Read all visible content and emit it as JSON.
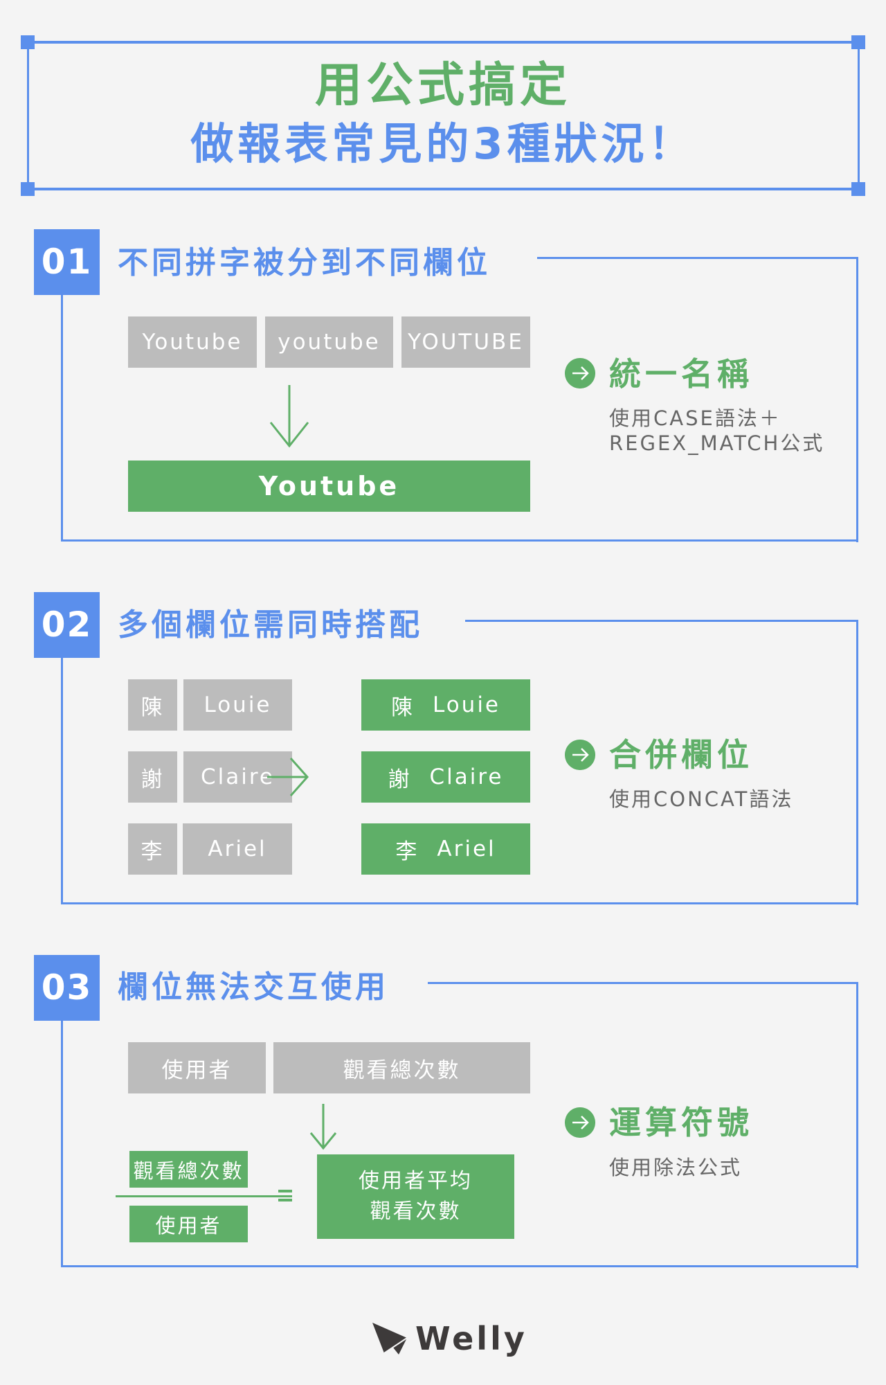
{
  "colors": {
    "background": "#f4f4f4",
    "accent_blue": "#5b8fec",
    "accent_green": "#5faf68",
    "gray_cell": "#bcbcbc",
    "desc_text": "#666666",
    "logo": "#3d3a3a"
  },
  "header": {
    "title_line1": "用公式搞定",
    "title_line2": "做報表常見的3種狀況！"
  },
  "sections": [
    {
      "number": "01",
      "title": "不同拼字被分到不同欄位",
      "inputs": [
        "Youtube",
        "youtube",
        "YOUTUBE"
      ],
      "output": "Youtube",
      "result_icon": "arrow-right-circle-icon",
      "result_title": "統一名稱",
      "result_desc_lines": [
        "使用CASE語法＋",
        "REGEX_MATCH公式"
      ]
    },
    {
      "number": "02",
      "title": "多個欄位需同時搭配",
      "rows": [
        {
          "surname": "陳",
          "name": "Louie"
        },
        {
          "surname": "謝",
          "name": "Claire"
        },
        {
          "surname": "李",
          "name": "Ariel"
        }
      ],
      "result_icon": "arrow-right-circle-icon",
      "result_title": "合併欄位",
      "result_desc_lines": [
        "使用CONCAT語法"
      ]
    },
    {
      "number": "03",
      "title": "欄位無法交互使用",
      "inputs": [
        "使用者",
        "觀看總次數"
      ],
      "numerator": "觀看總次數",
      "denominator": "使用者",
      "equals": "=",
      "result_lines": [
        "使用者平均",
        "觀看次數"
      ],
      "result_icon": "arrow-right-circle-icon",
      "result_title": "運算符號",
      "result_desc_lines": [
        "使用除法公式"
      ]
    }
  ],
  "footer": {
    "logo_icon": "paper-plane-icon",
    "logo_text": "Welly"
  }
}
